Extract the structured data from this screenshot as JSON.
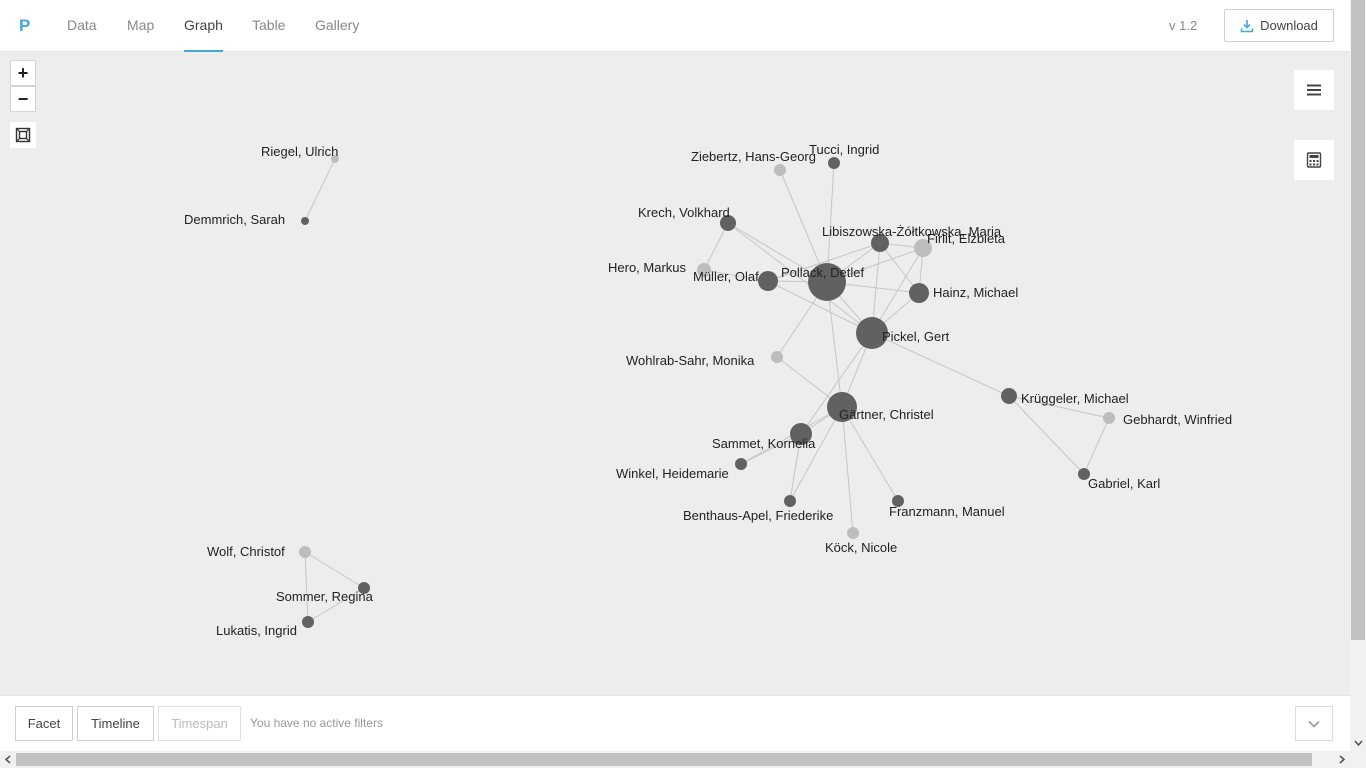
{
  "app": {
    "logo": "P",
    "version": "v 1.2"
  },
  "nav": {
    "tabs": [
      {
        "label": "Data",
        "active": false
      },
      {
        "label": "Map",
        "active": false
      },
      {
        "label": "Graph",
        "active": true
      },
      {
        "label": "Table",
        "active": false
      },
      {
        "label": "Gallery",
        "active": false
      }
    ],
    "download_label": "Download"
  },
  "controls": {
    "zoom_in": "+",
    "zoom_out": "−"
  },
  "colors": {
    "accent": "#45a9d8",
    "node_dark": "#616161",
    "node_light": "#bdbdbd",
    "edge": "#c6c6c6",
    "canvas_bg": "#ededed"
  },
  "graph": {
    "nodes": [
      {
        "id": "riegel",
        "label": "Riegel, Ulrich",
        "tone": "light"
      },
      {
        "id": "demmrich",
        "label": "Demmrich, Sarah",
        "tone": "dark"
      },
      {
        "id": "ziebertz",
        "label": "Ziebertz, Hans-Georg",
        "tone": "light"
      },
      {
        "id": "tucci",
        "label": "Tucci, Ingrid",
        "tone": "dark"
      },
      {
        "id": "krech",
        "label": "Krech, Volkhard",
        "tone": "dark"
      },
      {
        "id": "libiszowska",
        "label": "Libiszowska-Żółtkowska, Maria",
        "tone": "dark"
      },
      {
        "id": "firlit",
        "label": "Firlit, Elżbieta",
        "tone": "light"
      },
      {
        "id": "hero",
        "label": "Hero, Markus",
        "tone": "light"
      },
      {
        "id": "mueller",
        "label": "Müller, Olaf",
        "tone": "dark"
      },
      {
        "id": "pollack",
        "label": "Pollack, Detlef",
        "tone": "dark"
      },
      {
        "id": "hainz",
        "label": "Hainz, Michael",
        "tone": "dark"
      },
      {
        "id": "pickel",
        "label": "Pickel, Gert",
        "tone": "dark"
      },
      {
        "id": "wohlrab",
        "label": "Wohlrab-Sahr, Monika",
        "tone": "light"
      },
      {
        "id": "krueggeler",
        "label": "Krüggeler, Michael",
        "tone": "dark"
      },
      {
        "id": "gebhardt",
        "label": "Gebhardt, Winfried",
        "tone": "light"
      },
      {
        "id": "gaertner",
        "label": "Gärtner, Christel",
        "tone": "dark"
      },
      {
        "id": "sammet",
        "label": "Sammet, Kornelia",
        "tone": "dark"
      },
      {
        "id": "winkel",
        "label": "Winkel, Heidemarie",
        "tone": "dark"
      },
      {
        "id": "gabriel",
        "label": "Gabriel, Karl",
        "tone": "dark"
      },
      {
        "id": "benthaus",
        "label": "Benthaus-Apel, Friederike",
        "tone": "dark"
      },
      {
        "id": "franzmann",
        "label": "Franzmann, Manuel",
        "tone": "dark"
      },
      {
        "id": "koeck",
        "label": "Köck, Nicole",
        "tone": "light"
      },
      {
        "id": "wolf",
        "label": "Wolf, Christof",
        "tone": "light"
      },
      {
        "id": "sommer",
        "label": "Sommer, Regina",
        "tone": "dark"
      },
      {
        "id": "lukatis",
        "label": "Lukatis, Ingrid",
        "tone": "dark"
      }
    ],
    "edges": [
      [
        "riegel",
        "demmrich"
      ],
      [
        "ziebertz",
        "pollack"
      ],
      [
        "tucci",
        "pollack"
      ],
      [
        "krech",
        "pollack"
      ],
      [
        "krech",
        "hero"
      ],
      [
        "krech",
        "pickel"
      ],
      [
        "hero",
        "mueller"
      ],
      [
        "mueller",
        "pollack"
      ],
      [
        "mueller",
        "pickel"
      ],
      [
        "mueller",
        "libiszowska"
      ],
      [
        "pollack",
        "libiszowska"
      ],
      [
        "pollack",
        "firlit"
      ],
      [
        "pollack",
        "hainz"
      ],
      [
        "pollack",
        "pickel"
      ],
      [
        "pollack",
        "wohlrab"
      ],
      [
        "pollack",
        "gaertner"
      ],
      [
        "libiszowska",
        "firlit"
      ],
      [
        "libiszowska",
        "pickel"
      ],
      [
        "libiszowska",
        "hainz"
      ],
      [
        "firlit",
        "pickel"
      ],
      [
        "firlit",
        "hainz"
      ],
      [
        "hainz",
        "pickel"
      ],
      [
        "pickel",
        "gaertner"
      ],
      [
        "pickel",
        "krueggeler"
      ],
      [
        "pickel",
        "sammet"
      ],
      [
        "wohlrab",
        "gaertner"
      ],
      [
        "gaertner",
        "sammet"
      ],
      [
        "gaertner",
        "winkel"
      ],
      [
        "gaertner",
        "benthaus"
      ],
      [
        "gaertner",
        "franzmann"
      ],
      [
        "gaertner",
        "koeck"
      ],
      [
        "sammet",
        "winkel"
      ],
      [
        "sammet",
        "benthaus"
      ],
      [
        "krueggeler",
        "gebhardt"
      ],
      [
        "krueggeler",
        "gabriel"
      ],
      [
        "gebhardt",
        "gabriel"
      ],
      [
        "wolf",
        "sommer"
      ],
      [
        "wolf",
        "lukatis"
      ],
      [
        "sommer",
        "lukatis"
      ]
    ]
  },
  "filters": {
    "facet_label": "Facet",
    "timeline_label": "Timeline",
    "timespan_label": "Timespan",
    "status": "You have no active filters"
  }
}
